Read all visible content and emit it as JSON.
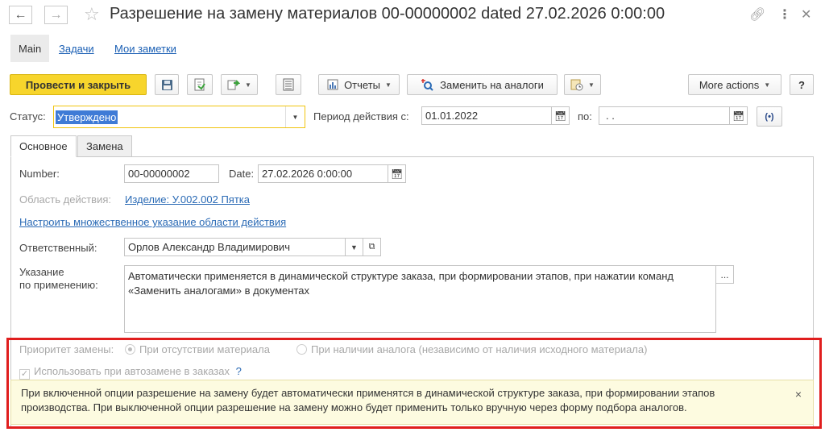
{
  "window": {
    "title": "Разрешение на замену материалов 00-00000002 dated 27.02.2026 0:00:00",
    "back_icon": "arrow-left-icon",
    "forward_icon": "arrow-right-icon",
    "favorite_icon": "star-icon"
  },
  "top_tabs": {
    "main": "Main",
    "tasks": "Задачи",
    "notes": "Мои заметки"
  },
  "toolbar": {
    "post_close": "Провести и закрыть",
    "reports": "Отчеты",
    "replace_analogs": "Заменить на аналоги",
    "more_actions": "More actions",
    "help": "?"
  },
  "status": {
    "label": "Статус:",
    "value": "Утверждено",
    "period_label": "Период действия с:",
    "period_from": "01.01.2022",
    "period_to_label": "по:",
    "period_to": " .  ."
  },
  "form_tabs": {
    "general": "Основное",
    "replacement": "Замена"
  },
  "general": {
    "number_label": "Number:",
    "number_value": "00-00000002",
    "date_label": "Date:",
    "date_value": "27.02.2026  0:00:00",
    "scope_label": "Область действия:",
    "scope_value": "Изделие: У.002.002 Пятка",
    "scope_setup_link": "Настроить множественное указание области действия",
    "responsible_label": "Ответственный:",
    "responsible_value": "Орлов Александр Владимирович",
    "instruction_label_1": "Указание",
    "instruction_label_2": "по применению:",
    "instruction_text": "Автоматически применяется в динамической структуре заказа, при формировании этапов, при нажатии команд «Заменить аналогами» в документах",
    "instruction_more": "..."
  },
  "priority": {
    "label": "Приоритет замены:",
    "option_1": "При отсутствии материала",
    "option_2": "При наличии аналога (независимо от наличия исходного материала)",
    "selected": 1
  },
  "auto_replace": {
    "label": "Использовать при автозамене в заказах",
    "checked": true,
    "help": "?"
  },
  "tooltip": {
    "text": "При включенной опции разрешение на замену будет автоматически применятся в динамической структуре заказа, при формировании этапов производства. При выключенной опции разрешение на замену можно будет применить только вручную через форму подбора аналогов.",
    "close": "×"
  },
  "colors": {
    "primary_button": "#f7d52c",
    "link": "#2a6ab5",
    "highlight_border": "#e01e1e",
    "tooltip_bg": "#fdfbe0"
  }
}
